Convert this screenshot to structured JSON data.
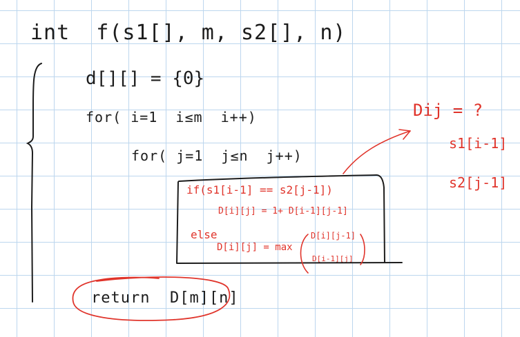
{
  "note": {
    "code": {
      "signature": "int  f(s1[], m, s2[], n)",
      "init": "d[][] = {0}",
      "outer_loop": "for( i=1  i≤m  i++)",
      "inner_loop": "for( j=1  j≤n  j++)",
      "return": "return  D[m][n]"
    },
    "annotation": {
      "if_line": "if(s1[i-1] == s2[j-1])",
      "match_line": "D[i][j] = 1+ D[i-1][j-1]",
      "else": "else",
      "max_line": "D[i][j] = max",
      "max_opt1": "D[i][j-1]",
      "max_opt2": "D[i-1][j]",
      "question": "Dij = ?",
      "s1_ref": "s1[i-1]",
      "s2_ref": "s2[j-1]"
    }
  },
  "colors": {
    "ink": "#1c1c1c",
    "red": "#e0342b",
    "grid": "#bcd6ee"
  }
}
